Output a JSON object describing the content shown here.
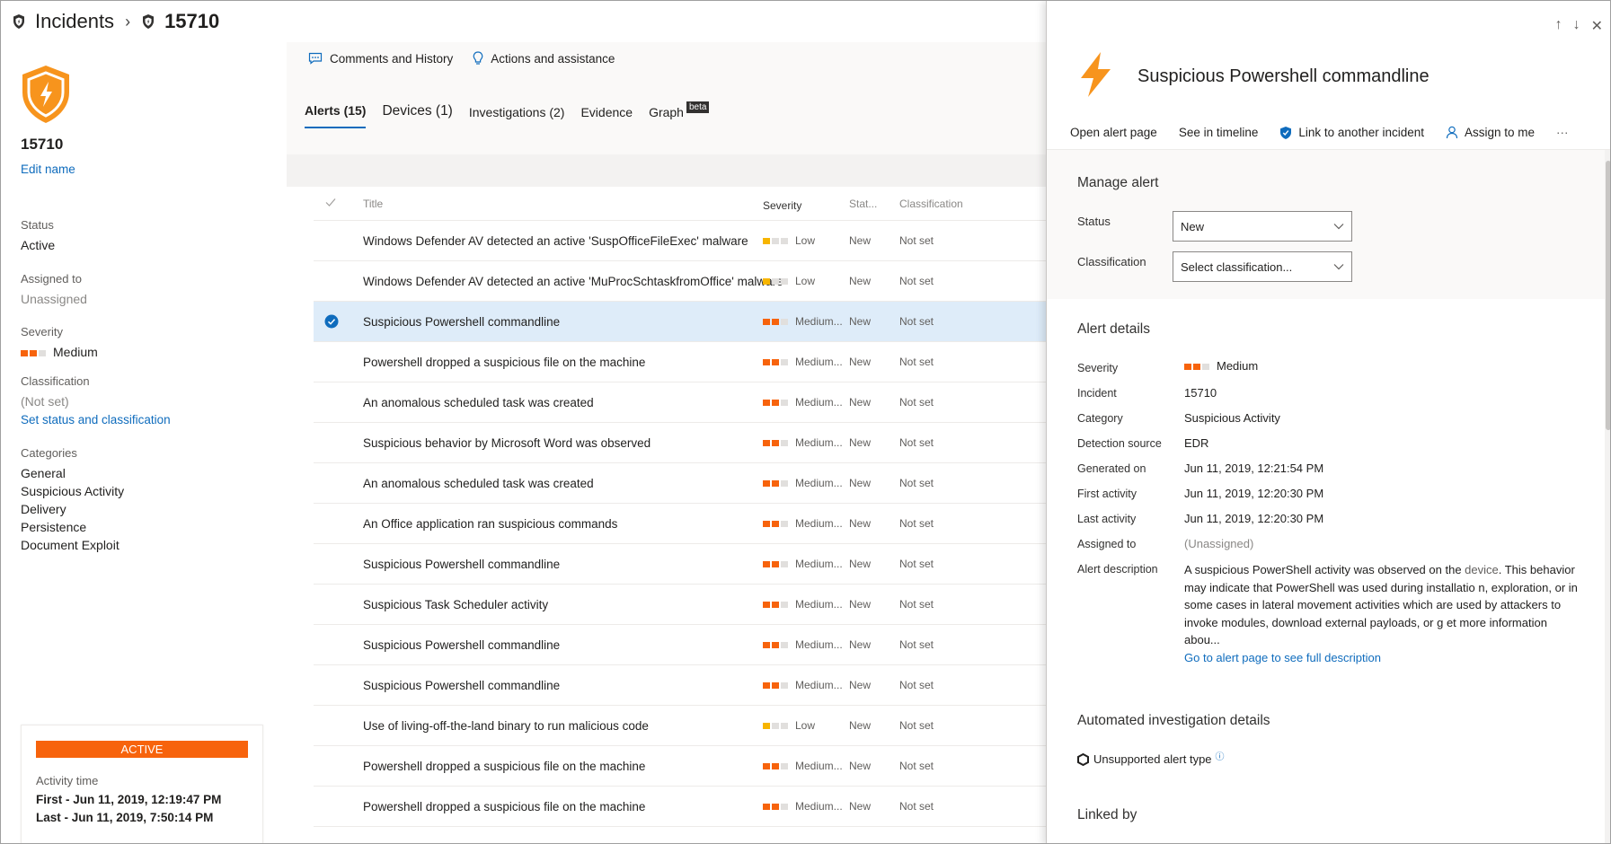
{
  "breadcrumb": {
    "root": "Incidents",
    "current": "15710"
  },
  "left_panel": {
    "incident_id": "15710",
    "edit_name": "Edit name",
    "status_label": "Status",
    "status_value": "Active",
    "assigned_label": "Assigned to",
    "assigned_value": "Unassigned",
    "severity_label": "Severity",
    "severity_value": "Medium",
    "classification_label": "Classification",
    "classification_value": "(Not set)",
    "set_status_link": "Set status and classification",
    "categories_label": "Categories",
    "categories": [
      "General",
      "Suspicious Activity",
      "Delivery",
      "Persistence",
      "Document Exploit"
    ],
    "status_card": {
      "badge": "ACTIVE",
      "activity_label": "Activity time",
      "first": "First - Jun 11, 2019, 12:19:47 PM",
      "last": "Last - Jun 11, 2019, 7:50:14 PM"
    }
  },
  "top_actions": {
    "comments": "Comments and History",
    "actions": "Actions and assistance"
  },
  "tabs": {
    "alerts": "Alerts (15)",
    "devices": "Devices (1)",
    "investigations": "Investigations (2)",
    "evidence": "Evidence",
    "graph": "Graph",
    "graph_badge": "beta"
  },
  "table": {
    "columns": {
      "title": "Title",
      "severity": "Severity",
      "status": "Stat...",
      "classification": "Classification"
    },
    "rows": [
      {
        "title": "Windows Defender AV detected an active 'SuspOfficeFileExec' malware",
        "severity": "Low",
        "status": "New",
        "classification": "Not set",
        "selected": false
      },
      {
        "title": "Windows Defender AV detected an active 'MuProcSchtaskfromOffice' malware",
        "severity": "Low",
        "status": "New",
        "classification": "Not set",
        "selected": false
      },
      {
        "title": "Suspicious Powershell commandline",
        "severity": "Medium...",
        "status": "New",
        "classification": "Not set",
        "selected": true
      },
      {
        "title": "Powershell dropped a suspicious file on the machine",
        "severity": "Medium...",
        "status": "New",
        "classification": "Not set",
        "selected": false
      },
      {
        "title": "An anomalous scheduled task was created",
        "severity": "Medium...",
        "status": "New",
        "classification": "Not set",
        "selected": false
      },
      {
        "title": "Suspicious behavior by Microsoft Word was observed",
        "severity": "Medium...",
        "status": "New",
        "classification": "Not set",
        "selected": false
      },
      {
        "title": "An anomalous scheduled task was created",
        "severity": "Medium...",
        "status": "New",
        "classification": "Not set",
        "selected": false
      },
      {
        "title": "An Office application ran suspicious commands",
        "severity": "Medium...",
        "status": "New",
        "classification": "Not set",
        "selected": false
      },
      {
        "title": "Suspicious Powershell commandline",
        "severity": "Medium...",
        "status": "New",
        "classification": "Not set",
        "selected": false
      },
      {
        "title": "Suspicious Task Scheduler activity",
        "severity": "Medium...",
        "status": "New",
        "classification": "Not set",
        "selected": false
      },
      {
        "title": "Suspicious Powershell commandline",
        "severity": "Medium...",
        "status": "New",
        "classification": "Not set",
        "selected": false
      },
      {
        "title": "Suspicious Powershell commandline",
        "severity": "Medium...",
        "status": "New",
        "classification": "Not set",
        "selected": false
      },
      {
        "title": "Use of living-off-the-land binary to run malicious code",
        "severity": "Low",
        "status": "New",
        "classification": "Not set",
        "selected": false
      },
      {
        "title": "Powershell dropped a suspicious file on the machine",
        "severity": "Medium...",
        "status": "New",
        "classification": "Not set",
        "selected": false
      },
      {
        "title": "Powershell dropped a suspicious file on the machine",
        "severity": "Medium...",
        "status": "New",
        "classification": "Not set",
        "selected": false
      }
    ]
  },
  "flyout": {
    "title": "Suspicious Powershell commandline",
    "toolbar": {
      "open_alert": "Open alert page",
      "timeline": "See in timeline",
      "link_incident": "Link to another incident",
      "assign": "Assign to me",
      "more": "···"
    },
    "manage": {
      "heading": "Manage alert",
      "status_label": "Status",
      "status_value": "New",
      "classification_label": "Classification",
      "classification_value": "Select classification..."
    },
    "details": {
      "heading": "Alert details",
      "severity_label": "Severity",
      "severity_value": "Medium",
      "incident_label": "Incident",
      "incident_value": "15710",
      "category_label": "Category",
      "category_value": "Suspicious Activity",
      "detection_label": "Detection source",
      "detection_value": "EDR",
      "generated_label": "Generated on",
      "generated_value": "Jun 11, 2019, 12:21:54 PM",
      "first_label": "First activity",
      "first_value": "Jun 11, 2019, 12:20:30 PM",
      "last_label": "Last activity",
      "last_value": "Jun 11, 2019, 12:20:30 PM",
      "assigned_label": "Assigned to",
      "assigned_value": "(Unassigned)",
      "description_label": "Alert description",
      "description_prefix": "A suspicious PowerShell activity was observed on the ",
      "description_device": "device",
      "description_rest": ". This behavior may indicate that PowerShell was used during installatio n, exploration, or in some cases in lateral movement activities which are used by attackers to invoke modules, download external payloads, or g et more information abou...",
      "description_link": "Go to alert page to see full description"
    },
    "automated": {
      "heading": "Automated investigation details",
      "unsupported": "Unsupported alert type",
      "info_glyph": "ⓘ"
    },
    "linked_heading": "Linked by"
  },
  "colors": {
    "accent": "#0f6cbd",
    "medium": "#f7630c",
    "low": "#f7b500",
    "selected_row": "#deecf9"
  },
  "icons": [
    "shield-icon",
    "chevron-right-icon",
    "comment-icon",
    "lightbulb-icon",
    "checkmark-icon",
    "lightning-icon",
    "arrow-up-icon",
    "arrow-down-icon",
    "close-icon",
    "shield-link-icon",
    "person-icon",
    "more-icon",
    "chevron-down-icon",
    "hexagon-icon",
    "info-icon"
  ]
}
